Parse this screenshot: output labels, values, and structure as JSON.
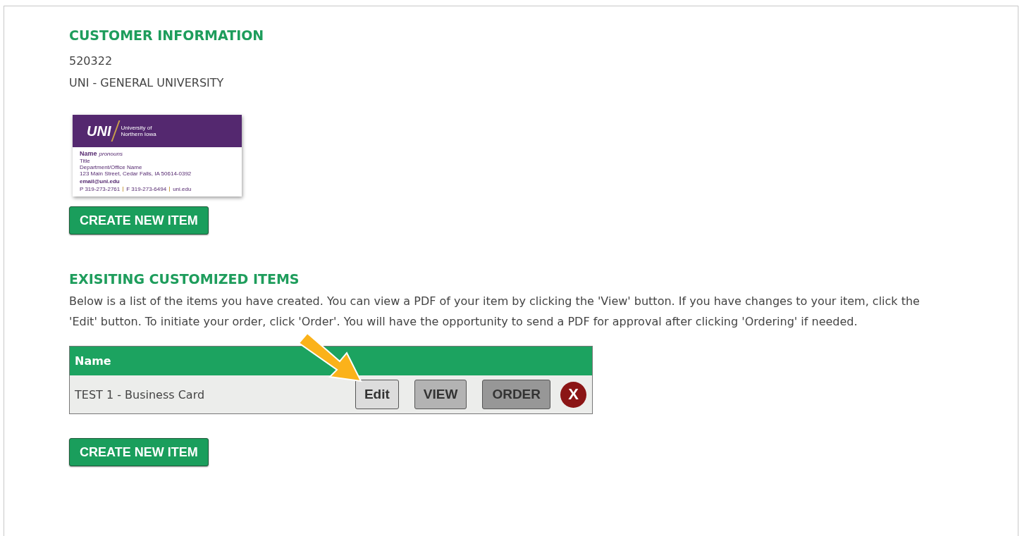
{
  "customer_information": {
    "heading": "CUSTOMER INFORMATION",
    "lines": [
      "520322",
      "UNI - GENERAL UNIVERSITY"
    ]
  },
  "item_preview": {
    "logo": "UNI",
    "institution": [
      "University of",
      "Northern Iowa"
    ],
    "name": "Name",
    "pronouns": "pronouns",
    "title": "Title",
    "department": "Department/Office Name",
    "address": "123 Main Street, Cedar Falls, IA 50614-0392",
    "email": "email@uni.edu",
    "contacts": [
      "P 319-273-2761",
      "F 319-273-6494",
      "uni.edu"
    ]
  },
  "create_buttons": [
    "CREATE NEW ITEM",
    "CREATE NEW ITEM"
  ],
  "existing_items": {
    "heading": "EXISITING CUSTOMIZED ITEMS",
    "description": "Below is a list of the items you have created. You can view a PDF of your item by clicking the 'View' button. If you have changes to your item, click the 'Edit' button. To initiate your order, click 'Order'. You will have the opportunity to send a PDF for approval after clicking 'Ordering' if needed.",
    "table": {
      "columns": [
        "Name"
      ],
      "rows": [
        {
          "name": "TEST 1 - Business Card",
          "actions": [
            {
              "kind": "edit",
              "label": "Edit"
            },
            {
              "kind": "view",
              "label": "VIEW"
            },
            {
              "kind": "order",
              "label": "ORDER"
            },
            {
              "kind": "delete",
              "label": "X"
            }
          ]
        }
      ]
    }
  }
}
